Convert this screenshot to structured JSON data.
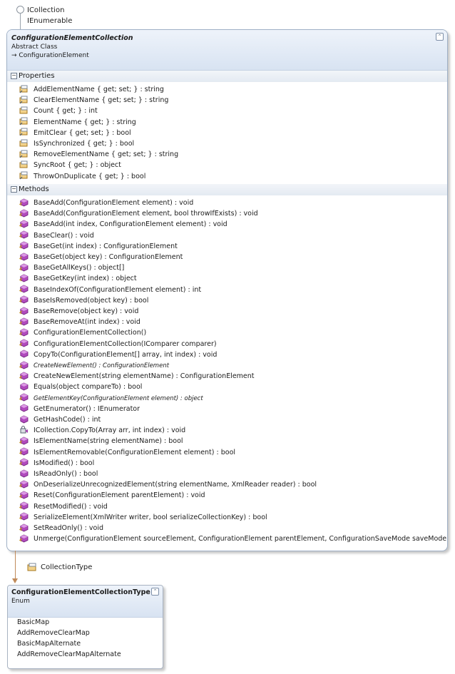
{
  "interfaces": [
    "ICollection",
    "IEnumerable"
  ],
  "class": {
    "name": "ConfigurationElementCollection",
    "kind": "Abstract Class",
    "base": "ConfigurationElement",
    "base_prefix": "→"
  },
  "properties_section": {
    "label": "Properties",
    "toggle": "−",
    "items": [
      "AddElementName { get; set; } : string",
      "ClearElementName { get; set; } : string",
      "Count { get; } : int",
      "ElementName { get; } : string",
      "EmitClear { get; set; } : bool",
      "IsSynchronized { get; } : bool",
      "RemoveElementName { get; set; } : string",
      "SyncRoot { get; } : object",
      "ThrowOnDuplicate { get; } : bool"
    ],
    "icons": [
      "protected-property-icon",
      "protected-property-icon",
      "public-property-icon",
      "protected-property-icon",
      "protected-property-icon",
      "public-property-icon",
      "protected-property-icon",
      "public-property-icon",
      "protected-property-icon"
    ]
  },
  "methods_section": {
    "label": "Methods",
    "toggle": "−",
    "items": [
      {
        "text": "BaseAdd(ConfigurationElement element) : void",
        "icon": "protected-method-icon",
        "italic": false
      },
      {
        "text": "BaseAdd(ConfigurationElement element, bool throwIfExists) : void",
        "icon": "protected-method-icon",
        "italic": false
      },
      {
        "text": "BaseAdd(int index, ConfigurationElement element) : void",
        "icon": "protected-method-icon",
        "italic": false
      },
      {
        "text": "BaseClear() : void",
        "icon": "protected-method-icon",
        "italic": false
      },
      {
        "text": "BaseGet(int index) : ConfigurationElement",
        "icon": "protected-method-icon",
        "italic": false
      },
      {
        "text": "BaseGet(object key) : ConfigurationElement",
        "icon": "protected-method-icon",
        "italic": false
      },
      {
        "text": "BaseGetAllKeys() : object[]",
        "icon": "protected-method-icon",
        "italic": false
      },
      {
        "text": "BaseGetKey(int index) : object",
        "icon": "protected-method-icon",
        "italic": false
      },
      {
        "text": "BaseIndexOf(ConfigurationElement element) : int",
        "icon": "protected-method-icon",
        "italic": false
      },
      {
        "text": "BaseIsRemoved(object key) : bool",
        "icon": "protected-method-icon",
        "italic": false
      },
      {
        "text": "BaseRemove(object key) : void",
        "icon": "protected-method-icon",
        "italic": false
      },
      {
        "text": "BaseRemoveAt(int index) : void",
        "icon": "protected-method-icon",
        "italic": false
      },
      {
        "text": "ConfigurationElementCollection()",
        "icon": "protected-method-icon",
        "italic": false
      },
      {
        "text": "ConfigurationElementCollection(IComparer comparer)",
        "icon": "protected-method-icon",
        "italic": false
      },
      {
        "text": "CopyTo(ConfigurationElement[] array, int index) : void",
        "icon": "public-method-icon",
        "italic": false
      },
      {
        "text": "CreateNewElement() : ConfigurationElement",
        "icon": "protected-method-icon",
        "italic": true
      },
      {
        "text": "CreateNewElement(string elementName) : ConfigurationElement",
        "icon": "protected-method-icon",
        "italic": false
      },
      {
        "text": "Equals(object compareTo) : bool",
        "icon": "public-method-icon",
        "italic": false
      },
      {
        "text": "GetElementKey(ConfigurationElement element) : object",
        "icon": "protected-method-icon",
        "italic": true
      },
      {
        "text": "GetEnumerator() : IEnumerator",
        "icon": "public-method-icon",
        "italic": false
      },
      {
        "text": "GetHashCode() : int",
        "icon": "public-method-icon",
        "italic": false
      },
      {
        "text": "ICollection.CopyTo(Array arr, int index) : void",
        "icon": "private-method-icon",
        "italic": false
      },
      {
        "text": "IsElementName(string elementName) : bool",
        "icon": "protected-method-icon",
        "italic": false
      },
      {
        "text": "IsElementRemovable(ConfigurationElement element) : bool",
        "icon": "protected-method-icon",
        "italic": false
      },
      {
        "text": "IsModified() : bool",
        "icon": "protected-method-icon",
        "italic": false
      },
      {
        "text": "IsReadOnly() : bool",
        "icon": "public-method-icon",
        "italic": false
      },
      {
        "text": "OnDeserializeUnrecognizedElement(string elementName, XmlReader reader) : bool",
        "icon": "protected-method-icon",
        "italic": false
      },
      {
        "text": "Reset(ConfigurationElement parentElement) : void",
        "icon": "protected-method-icon",
        "italic": false
      },
      {
        "text": "ResetModified() : void",
        "icon": "protected-method-icon",
        "italic": false
      },
      {
        "text": "SerializeElement(XmlWriter writer, bool serializeCollectionKey) : bool",
        "icon": "protected-method-icon",
        "italic": false
      },
      {
        "text": "SetReadOnly() : void",
        "icon": "protected-method-icon",
        "italic": false
      },
      {
        "text": "Unmerge(ConfigurationElement  sourceElement,  ConfigurationElement  parentElement,  ConfigurationSaveMode  saveMode) : v...",
        "icon": "protected-method-icon",
        "italic": false
      }
    ]
  },
  "association": {
    "label": "CollectionType"
  },
  "enum": {
    "name": "ConfigurationElementCollectionType",
    "kind": "Enum",
    "values": [
      "BasicMap",
      "AddRemoveClearMap",
      "BasicMapAlternate",
      "AddRemoveClearMapAlternate"
    ]
  },
  "colors": {
    "header_top": "#eef3fa",
    "header_bottom": "#d8e3f2",
    "box_border": "#9fb0c6",
    "method_icon": "#a43fb0",
    "property_icon": "#e7b54a",
    "association_line": "#c08a5a"
  }
}
